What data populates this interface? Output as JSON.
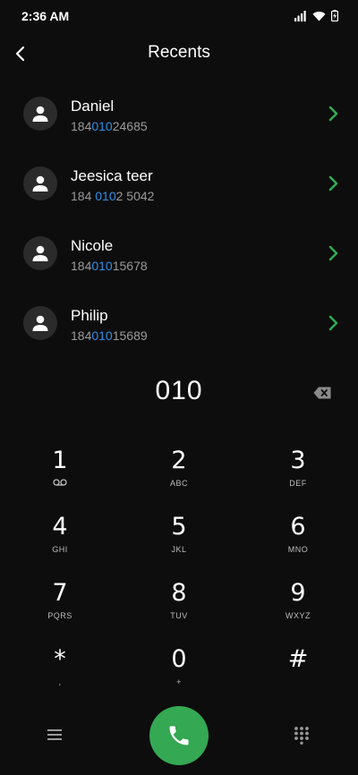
{
  "status": {
    "time": "2:36 AM"
  },
  "header": {
    "title": "Recents"
  },
  "contacts": [
    {
      "name": "Daniel",
      "number_pre": "184",
      "number_match": "010",
      "number_post": "24685"
    },
    {
      "name": "Jeesica teer",
      "number_pre": "184 ",
      "number_match": "010",
      "number_post": "2 5042"
    },
    {
      "name": "Nicole",
      "number_pre": "184",
      "number_match": "010",
      "number_post": "15678"
    },
    {
      "name": "Philip",
      "number_pre": "184",
      "number_match": "010",
      "number_post": "15689"
    }
  ],
  "dialed": "010",
  "keys": [
    {
      "digit": "1",
      "letters": ""
    },
    {
      "digit": "2",
      "letters": "ABC"
    },
    {
      "digit": "3",
      "letters": "DEF"
    },
    {
      "digit": "4",
      "letters": "GHI"
    },
    {
      "digit": "5",
      "letters": "JKL"
    },
    {
      "digit": "6",
      "letters": "MNO"
    },
    {
      "digit": "7",
      "letters": "PQRS"
    },
    {
      "digit": "8",
      "letters": "TUV"
    },
    {
      "digit": "9",
      "letters": "WXYZ"
    },
    {
      "digit": "*",
      "letters": ","
    },
    {
      "digit": "0",
      "letters": "+"
    },
    {
      "digit": "#",
      "letters": ""
    }
  ],
  "colors": {
    "background": "#0d0d0d",
    "match_highlight": "#2d8fe6",
    "arrow_green": "#34a853",
    "call_button": "#34a853"
  },
  "icons": {
    "back": "chevron-left-icon",
    "contact": "person-icon",
    "row_action": "chevron-right-icon",
    "backspace": "backspace-icon",
    "voicemail": "voicemail-icon",
    "menu": "menu-icon",
    "call": "phone-icon",
    "dialpad": "dialpad-icon"
  }
}
